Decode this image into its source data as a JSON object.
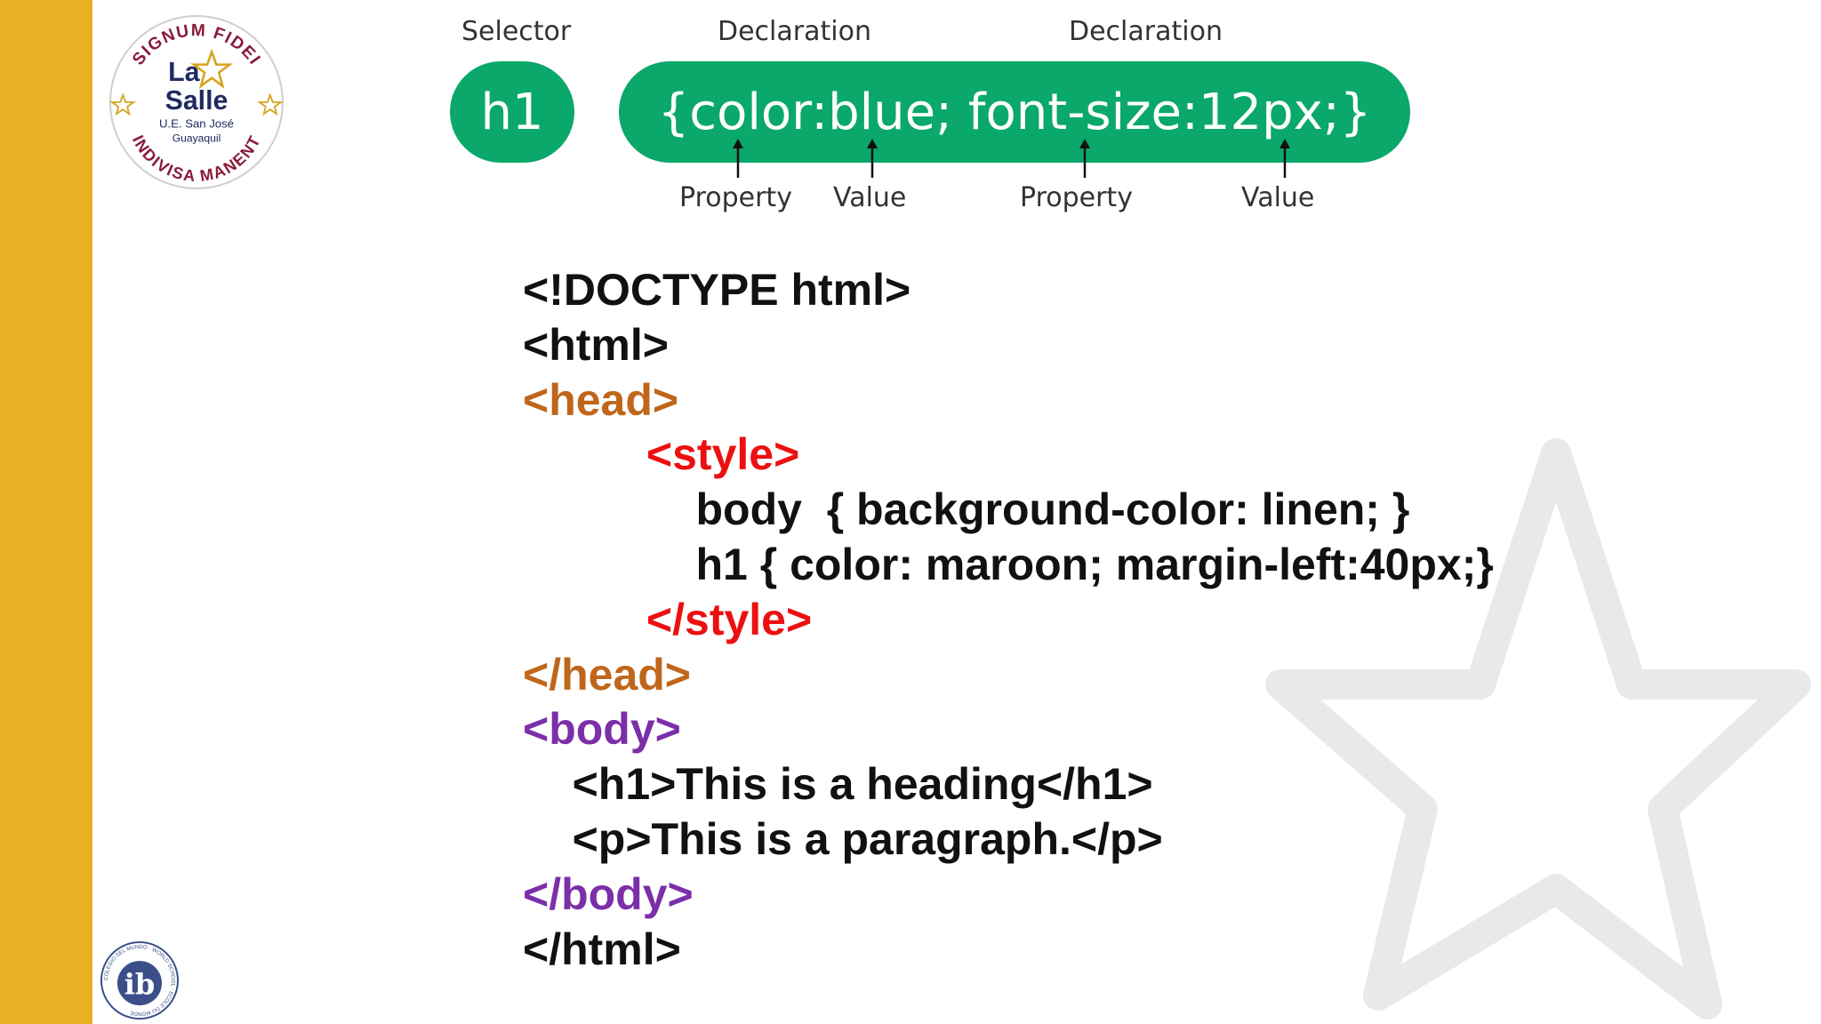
{
  "colors": {
    "sidebar": "#E8B024",
    "pill_green": "#0AA86A",
    "code_black": "#111111",
    "code_orange": "#C0661B",
    "code_red": "#EC1010",
    "code_purple": "#7B2FA8"
  },
  "logo": {
    "top_arc": "SIGNUM FIDEI",
    "line1": "La",
    "line2": "Salle",
    "line3": "U.E. San José",
    "line4": "Guayaquil",
    "bottom_arc": "INDIVISA MANENT"
  },
  "ib_logo": {
    "letters": "ib",
    "ring_text": "COLEGIO DEL MUNDO · WORLD SCHOOL · ÉCOLE DU MONDE"
  },
  "diagram": {
    "selector_label": "Selector",
    "declaration_label_1": "Declaration",
    "declaration_label_2": "Declaration",
    "selector": "h1",
    "declaration_block": "{color:blue; font-size:12px;}",
    "property_label_1": "Property",
    "value_label_1": "Value",
    "property_label_2": "Property",
    "value_label_2": "Value"
  },
  "code": [
    {
      "text": "<!DOCTYPE html>",
      "indent": "",
      "color": "black"
    },
    {
      "text": "<html>",
      "indent": "",
      "color": "black"
    },
    {
      "text": "<head>",
      "indent": "",
      "color": "orange"
    },
    {
      "text": "<style>",
      "indent": "          ",
      "color": "red"
    },
    {
      "text": "body  { background-color: linen; }",
      "indent": "              ",
      "color": "black"
    },
    {
      "text": "h1 { color: maroon; margin-left:40px;}",
      "indent": "              ",
      "color": "black"
    },
    {
      "text": "</style>",
      "indent": "          ",
      "color": "red"
    },
    {
      "text": "</head>",
      "indent": "",
      "color": "orange"
    },
    {
      "text": "<body>",
      "indent": "",
      "color": "purple"
    },
    {
      "text": "<h1>This is a heading</h1>",
      "indent": "    ",
      "color": "black"
    },
    {
      "text": "<p>This is a paragraph.</p>",
      "indent": "    ",
      "color": "black"
    },
    {
      "text": "</body>",
      "indent": "",
      "color": "purple"
    },
    {
      "text": "</html>",
      "indent": "",
      "color": "black"
    }
  ]
}
